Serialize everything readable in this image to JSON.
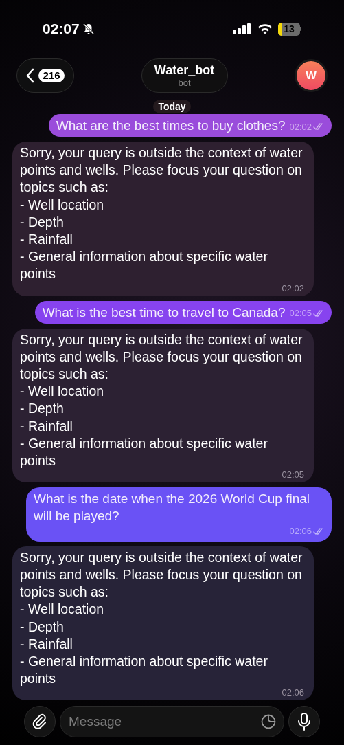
{
  "status_bar": {
    "time": "02:07",
    "muted": true,
    "battery": "13"
  },
  "header": {
    "back_count": "216",
    "title": "Water_bot",
    "subtitle": "bot",
    "avatar_letter": "W"
  },
  "date_chip": "Today",
  "messages": [
    {
      "kind": "out",
      "text": "What are the best times to buy clothes?",
      "time": "02:02",
      "read": true
    },
    {
      "kind": "in",
      "text": "Sorry, your query is outside the context of water points and wells. Please focus your question on topics such as:\n- Well location\n- Depth\n- Rainfall\n- General information about specific water points",
      "time": "02:02"
    },
    {
      "kind": "out",
      "text": "What is the best time to travel to Canada?",
      "time": "02:05",
      "read": true
    },
    {
      "kind": "in",
      "text": "Sorry, your query is outside the context of water points and wells. Please focus your question on topics such as:\n- Well location\n- Depth\n- Rainfall\n- General information about specific water points",
      "time": "02:05"
    },
    {
      "kind": "out",
      "text": "What is the date when the 2026 World Cup final will be played?",
      "time": "02:06",
      "read": true
    },
    {
      "kind": "in",
      "text": "Sorry, your query is outside the context of water points and wells. Please focus your question on topics such as:\n- Well location\n- Depth\n- Rainfall\n- General information about specific water points",
      "time": "02:06"
    }
  ],
  "composer": {
    "placeholder": "Message"
  }
}
